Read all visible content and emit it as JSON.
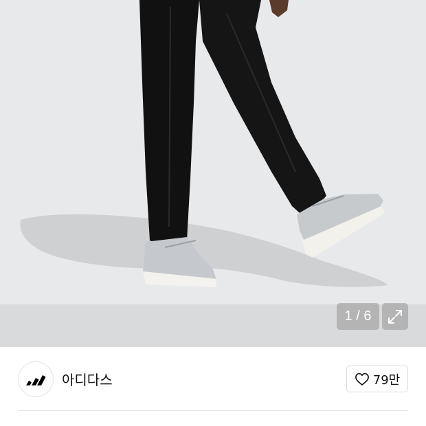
{
  "gallery": {
    "counter_text": "1 / 6",
    "expand_icon": "expand-icon",
    "colors": {
      "background": "#e3e4e6",
      "floor": "#d5d6d8",
      "pants": "#0f0f10",
      "sneaker": "#c4c8cc",
      "sole": "#f1f1ef"
    }
  },
  "brand": {
    "logo_icon": "adidas-logo",
    "name": "아디다스"
  },
  "like": {
    "icon": "heart-outline-icon",
    "count": "79만"
  }
}
